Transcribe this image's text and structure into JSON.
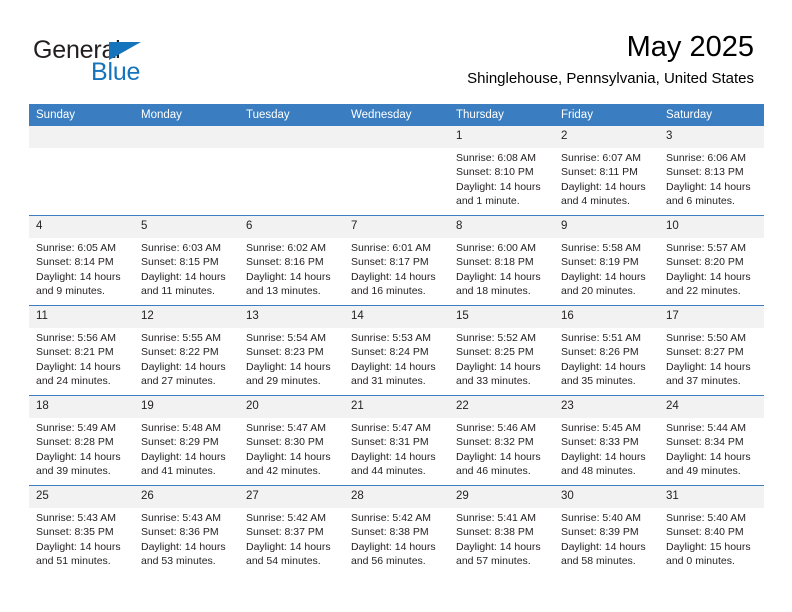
{
  "brand": {
    "word1": "General",
    "word2": "Blue",
    "triangle_color": "#1574bb",
    "text_color": "#231f20"
  },
  "header": {
    "month_title": "May 2025",
    "location": "Shinglehouse, Pennsylvania, United States"
  },
  "theme": {
    "header_blue": "#3a7dc0",
    "daynum_band": "#f2f2f2",
    "text": "#231f20"
  },
  "calendar": {
    "weekday_headers": [
      "Sunday",
      "Monday",
      "Tuesday",
      "Wednesday",
      "Thursday",
      "Friday",
      "Saturday"
    ],
    "weeks": [
      [
        {
          "day": "",
          "empty": true,
          "sunrise": "",
          "sunset": "",
          "daylight_1": "",
          "daylight_2": ""
        },
        {
          "day": "",
          "empty": true,
          "sunrise": "",
          "sunset": "",
          "daylight_1": "",
          "daylight_2": ""
        },
        {
          "day": "",
          "empty": true,
          "sunrise": "",
          "sunset": "",
          "daylight_1": "",
          "daylight_2": ""
        },
        {
          "day": "",
          "empty": true,
          "sunrise": "",
          "sunset": "",
          "daylight_1": "",
          "daylight_2": ""
        },
        {
          "day": "1",
          "empty": false,
          "sunrise": "Sunrise: 6:08 AM",
          "sunset": "Sunset: 8:10 PM",
          "daylight_1": "Daylight: 14 hours",
          "daylight_2": "and 1 minute."
        },
        {
          "day": "2",
          "empty": false,
          "sunrise": "Sunrise: 6:07 AM",
          "sunset": "Sunset: 8:11 PM",
          "daylight_1": "Daylight: 14 hours",
          "daylight_2": "and 4 minutes."
        },
        {
          "day": "3",
          "empty": false,
          "sunrise": "Sunrise: 6:06 AM",
          "sunset": "Sunset: 8:13 PM",
          "daylight_1": "Daylight: 14 hours",
          "daylight_2": "and 6 minutes."
        }
      ],
      [
        {
          "day": "4",
          "empty": false,
          "sunrise": "Sunrise: 6:05 AM",
          "sunset": "Sunset: 8:14 PM",
          "daylight_1": "Daylight: 14 hours",
          "daylight_2": "and 9 minutes."
        },
        {
          "day": "5",
          "empty": false,
          "sunrise": "Sunrise: 6:03 AM",
          "sunset": "Sunset: 8:15 PM",
          "daylight_1": "Daylight: 14 hours",
          "daylight_2": "and 11 minutes."
        },
        {
          "day": "6",
          "empty": false,
          "sunrise": "Sunrise: 6:02 AM",
          "sunset": "Sunset: 8:16 PM",
          "daylight_1": "Daylight: 14 hours",
          "daylight_2": "and 13 minutes."
        },
        {
          "day": "7",
          "empty": false,
          "sunrise": "Sunrise: 6:01 AM",
          "sunset": "Sunset: 8:17 PM",
          "daylight_1": "Daylight: 14 hours",
          "daylight_2": "and 16 minutes."
        },
        {
          "day": "8",
          "empty": false,
          "sunrise": "Sunrise: 6:00 AM",
          "sunset": "Sunset: 8:18 PM",
          "daylight_1": "Daylight: 14 hours",
          "daylight_2": "and 18 minutes."
        },
        {
          "day": "9",
          "empty": false,
          "sunrise": "Sunrise: 5:58 AM",
          "sunset": "Sunset: 8:19 PM",
          "daylight_1": "Daylight: 14 hours",
          "daylight_2": "and 20 minutes."
        },
        {
          "day": "10",
          "empty": false,
          "sunrise": "Sunrise: 5:57 AM",
          "sunset": "Sunset: 8:20 PM",
          "daylight_1": "Daylight: 14 hours",
          "daylight_2": "and 22 minutes."
        }
      ],
      [
        {
          "day": "11",
          "empty": false,
          "sunrise": "Sunrise: 5:56 AM",
          "sunset": "Sunset: 8:21 PM",
          "daylight_1": "Daylight: 14 hours",
          "daylight_2": "and 24 minutes."
        },
        {
          "day": "12",
          "empty": false,
          "sunrise": "Sunrise: 5:55 AM",
          "sunset": "Sunset: 8:22 PM",
          "daylight_1": "Daylight: 14 hours",
          "daylight_2": "and 27 minutes."
        },
        {
          "day": "13",
          "empty": false,
          "sunrise": "Sunrise: 5:54 AM",
          "sunset": "Sunset: 8:23 PM",
          "daylight_1": "Daylight: 14 hours",
          "daylight_2": "and 29 minutes."
        },
        {
          "day": "14",
          "empty": false,
          "sunrise": "Sunrise: 5:53 AM",
          "sunset": "Sunset: 8:24 PM",
          "daylight_1": "Daylight: 14 hours",
          "daylight_2": "and 31 minutes."
        },
        {
          "day": "15",
          "empty": false,
          "sunrise": "Sunrise: 5:52 AM",
          "sunset": "Sunset: 8:25 PM",
          "daylight_1": "Daylight: 14 hours",
          "daylight_2": "and 33 minutes."
        },
        {
          "day": "16",
          "empty": false,
          "sunrise": "Sunrise: 5:51 AM",
          "sunset": "Sunset: 8:26 PM",
          "daylight_1": "Daylight: 14 hours",
          "daylight_2": "and 35 minutes."
        },
        {
          "day": "17",
          "empty": false,
          "sunrise": "Sunrise: 5:50 AM",
          "sunset": "Sunset: 8:27 PM",
          "daylight_1": "Daylight: 14 hours",
          "daylight_2": "and 37 minutes."
        }
      ],
      [
        {
          "day": "18",
          "empty": false,
          "sunrise": "Sunrise: 5:49 AM",
          "sunset": "Sunset: 8:28 PM",
          "daylight_1": "Daylight: 14 hours",
          "daylight_2": "and 39 minutes."
        },
        {
          "day": "19",
          "empty": false,
          "sunrise": "Sunrise: 5:48 AM",
          "sunset": "Sunset: 8:29 PM",
          "daylight_1": "Daylight: 14 hours",
          "daylight_2": "and 41 minutes."
        },
        {
          "day": "20",
          "empty": false,
          "sunrise": "Sunrise: 5:47 AM",
          "sunset": "Sunset: 8:30 PM",
          "daylight_1": "Daylight: 14 hours",
          "daylight_2": "and 42 minutes."
        },
        {
          "day": "21",
          "empty": false,
          "sunrise": "Sunrise: 5:47 AM",
          "sunset": "Sunset: 8:31 PM",
          "daylight_1": "Daylight: 14 hours",
          "daylight_2": "and 44 minutes."
        },
        {
          "day": "22",
          "empty": false,
          "sunrise": "Sunrise: 5:46 AM",
          "sunset": "Sunset: 8:32 PM",
          "daylight_1": "Daylight: 14 hours",
          "daylight_2": "and 46 minutes."
        },
        {
          "day": "23",
          "empty": false,
          "sunrise": "Sunrise: 5:45 AM",
          "sunset": "Sunset: 8:33 PM",
          "daylight_1": "Daylight: 14 hours",
          "daylight_2": "and 48 minutes."
        },
        {
          "day": "24",
          "empty": false,
          "sunrise": "Sunrise: 5:44 AM",
          "sunset": "Sunset: 8:34 PM",
          "daylight_1": "Daylight: 14 hours",
          "daylight_2": "and 49 minutes."
        }
      ],
      [
        {
          "day": "25",
          "empty": false,
          "sunrise": "Sunrise: 5:43 AM",
          "sunset": "Sunset: 8:35 PM",
          "daylight_1": "Daylight: 14 hours",
          "daylight_2": "and 51 minutes."
        },
        {
          "day": "26",
          "empty": false,
          "sunrise": "Sunrise: 5:43 AM",
          "sunset": "Sunset: 8:36 PM",
          "daylight_1": "Daylight: 14 hours",
          "daylight_2": "and 53 minutes."
        },
        {
          "day": "27",
          "empty": false,
          "sunrise": "Sunrise: 5:42 AM",
          "sunset": "Sunset: 8:37 PM",
          "daylight_1": "Daylight: 14 hours",
          "daylight_2": "and 54 minutes."
        },
        {
          "day": "28",
          "empty": false,
          "sunrise": "Sunrise: 5:42 AM",
          "sunset": "Sunset: 8:38 PM",
          "daylight_1": "Daylight: 14 hours",
          "daylight_2": "and 56 minutes."
        },
        {
          "day": "29",
          "empty": false,
          "sunrise": "Sunrise: 5:41 AM",
          "sunset": "Sunset: 8:38 PM",
          "daylight_1": "Daylight: 14 hours",
          "daylight_2": "and 57 minutes."
        },
        {
          "day": "30",
          "empty": false,
          "sunrise": "Sunrise: 5:40 AM",
          "sunset": "Sunset: 8:39 PM",
          "daylight_1": "Daylight: 14 hours",
          "daylight_2": "and 58 minutes."
        },
        {
          "day": "31",
          "empty": false,
          "sunrise": "Sunrise: 5:40 AM",
          "sunset": "Sunset: 8:40 PM",
          "daylight_1": "Daylight: 15 hours",
          "daylight_2": "and 0 minutes."
        }
      ]
    ]
  }
}
